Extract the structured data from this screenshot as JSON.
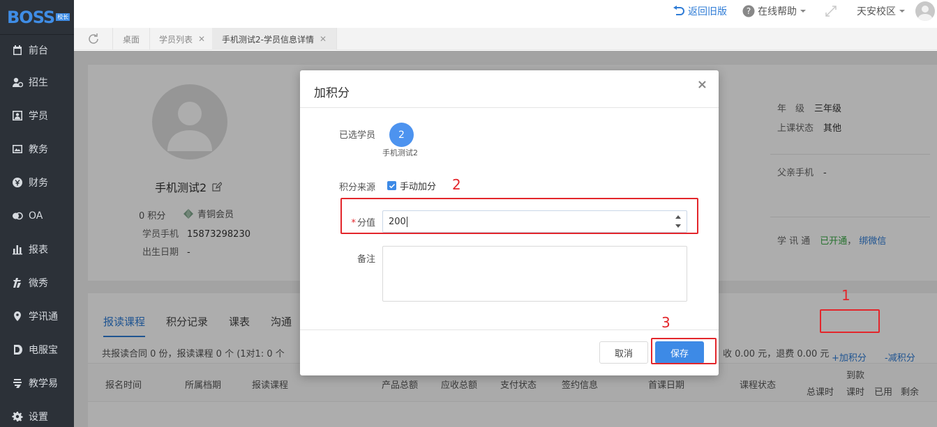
{
  "app": {
    "logo_text": "BOSS",
    "logo_tag": "校长"
  },
  "sidebar": {
    "items": [
      {
        "label": "前台",
        "icon": "calendar-icon"
      },
      {
        "label": "招生",
        "icon": "recruit-icon"
      },
      {
        "label": "学员",
        "icon": "student-icon"
      },
      {
        "label": "教务",
        "icon": "academic-icon"
      },
      {
        "label": "财务",
        "icon": "finance-icon"
      },
      {
        "label": "OA",
        "icon": "oa-icon"
      },
      {
        "label": "报表",
        "icon": "report-icon"
      },
      {
        "label": "微秀",
        "icon": "weixiu-icon"
      },
      {
        "label": "学讯通",
        "icon": "location-icon"
      },
      {
        "label": "电服宝",
        "icon": "service-icon"
      },
      {
        "label": "教学易",
        "icon": "teaching-icon"
      },
      {
        "label": "设置",
        "icon": "gear-icon"
      }
    ]
  },
  "header": {
    "back_old": "返回旧版",
    "help": "在线帮助",
    "campus": "天安校区"
  },
  "tabs": [
    {
      "label": "桌面",
      "closable": false,
      "active": false
    },
    {
      "label": "学员列表",
      "closable": true,
      "active": false
    },
    {
      "label": "手机测试2-学员信息详情",
      "closable": true,
      "active": true
    }
  ],
  "profile": {
    "name": "手机测试2",
    "points_value": "0",
    "points_label": "积分",
    "member_level": "青铜会员",
    "phone_label": "学员手机",
    "phone": "15873298230",
    "birthday_label": "出生日期",
    "birthday": "-"
  },
  "right_info": {
    "grade_label": "年　级",
    "grade": "三年级",
    "status_label": "上课状态",
    "status": "其他",
    "father_label": "父亲手机",
    "father": "-",
    "xxt_label": "学 讯 通",
    "xxt_status": "已开通",
    "xxt_sep": "，",
    "xxt_bind": "绑微信"
  },
  "detail_tabs": [
    "报读课程",
    "积分记录",
    "课表",
    "沟通"
  ],
  "actions": {
    "add_points": "+加积分",
    "sub_points": "-减积分"
  },
  "summary": {
    "left": "共报读合同 0 份，报读课程 0 个 (1对1: 0 个",
    "right": "收 0.00 元，退费 0.00 元"
  },
  "table": {
    "headers": [
      "报名时间",
      "所属档期",
      "报读课程",
      "产品总额",
      "应收总额",
      "支付状态",
      "签约信息",
      "首课日期",
      "课程状态"
    ],
    "hours_header_top": "到款",
    "hours_headers": [
      "总课时",
      "课时",
      "已用",
      "剩余"
    ]
  },
  "modal": {
    "title": "加积分",
    "selected_label": "已选学员",
    "selected_count": "2",
    "selected_name": "手机测试2",
    "source_label": "积分来源",
    "source_option": "手动加分",
    "score_label": "分值",
    "score_value": "200",
    "note_label": "备注",
    "cancel": "取消",
    "save": "保存"
  },
  "annotations": {
    "one": "1",
    "two": "2",
    "three": "3"
  },
  "colors": {
    "accent": "#3d8ae6",
    "sidebar_bg": "#2c3138",
    "annotation": "#e3262b",
    "success": "#3aa846"
  }
}
